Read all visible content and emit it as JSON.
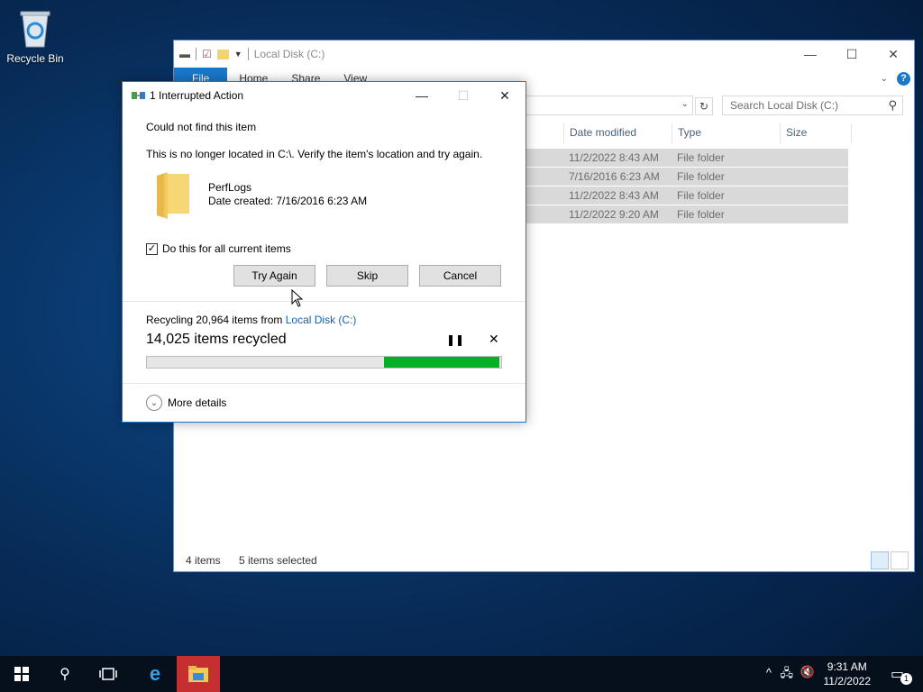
{
  "desktop": {
    "recycle_bin_label": "Recycle Bin"
  },
  "explorer": {
    "title": "Local Disk (C:)",
    "ribbon_tabs": [
      "File",
      "Home",
      "Share",
      "View"
    ],
    "search_placeholder": "Search Local Disk (C:)",
    "columns": [
      "Date modified",
      "Type",
      "Size"
    ],
    "rows": [
      {
        "date": "11/2/2022 8:43 AM",
        "type": "File folder"
      },
      {
        "date": "7/16/2016 6:23 AM",
        "type": "File folder"
      },
      {
        "date": "11/2/2022 8:43 AM",
        "type": "File folder"
      },
      {
        "date": "11/2/2022 9:20 AM",
        "type": "File folder"
      }
    ],
    "status_items": "4 items",
    "status_selected": "5 items selected"
  },
  "dialog": {
    "title": "1 Interrupted Action",
    "heading": "Could not find this item",
    "message": "This is no longer located in C:\\. Verify the item's location and try again.",
    "item_name": "PerfLogs",
    "item_date": "Date created: 7/16/2016 6:23 AM",
    "checkbox_label": "Do this for all current items",
    "checkbox_checked": true,
    "buttons": {
      "try_again": "Try Again",
      "skip": "Skip",
      "cancel": "Cancel"
    },
    "progress_prefix": "Recycling 20,964 items from ",
    "progress_source": "Local Disk (C:)",
    "progress_count": "14,025 items recycled",
    "progress_fraction": 0.67,
    "more_details": "More details"
  },
  "taskbar": {
    "time": "9:31 AM",
    "date": "11/2/2022",
    "notification_count": "1"
  },
  "colors": {
    "accent": "#1979ca",
    "progress": "#06b025",
    "active_task": "#c62f2f"
  }
}
